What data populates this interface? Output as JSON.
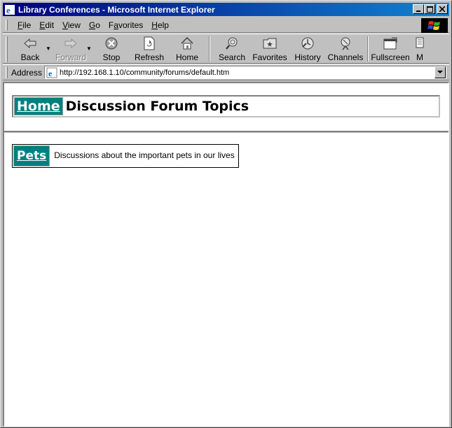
{
  "window": {
    "title": "Library Conferences - Microsoft Internet Explorer"
  },
  "menubar": {
    "items": [
      {
        "label": "File",
        "accel": "F",
        "rest": "ile"
      },
      {
        "label": "Edit",
        "accel": "E",
        "rest": "dit"
      },
      {
        "label": "View",
        "accel": "V",
        "rest": "iew"
      },
      {
        "label": "Go",
        "accel": "G",
        "rest": "o"
      },
      {
        "label": "Favorites",
        "accel": "a",
        "pre": "F",
        "rest": "vorites"
      },
      {
        "label": "Help",
        "accel": "H",
        "rest": "elp"
      }
    ]
  },
  "toolbar": {
    "back": "Back",
    "forward": "Forward",
    "stop": "Stop",
    "refresh": "Refresh",
    "home": "Home",
    "search": "Search",
    "favorites": "Favorites",
    "history": "History",
    "channels": "Channels",
    "fullscreen": "Fullscreen",
    "mail": "M"
  },
  "address": {
    "label": "Address",
    "url": "http://192.168.1.10/community/forums/default.htm"
  },
  "page": {
    "home_link": "Home",
    "title": "Discussion Forum Topics",
    "topics": [
      {
        "name": "Pets",
        "description": "Discussions about the important pets in our lives"
      }
    ]
  },
  "colors": {
    "titlebar_start": "#000080",
    "titlebar_end": "#1084d0",
    "link_cell_bg": "#008080",
    "chrome": "#c0c0c0"
  }
}
